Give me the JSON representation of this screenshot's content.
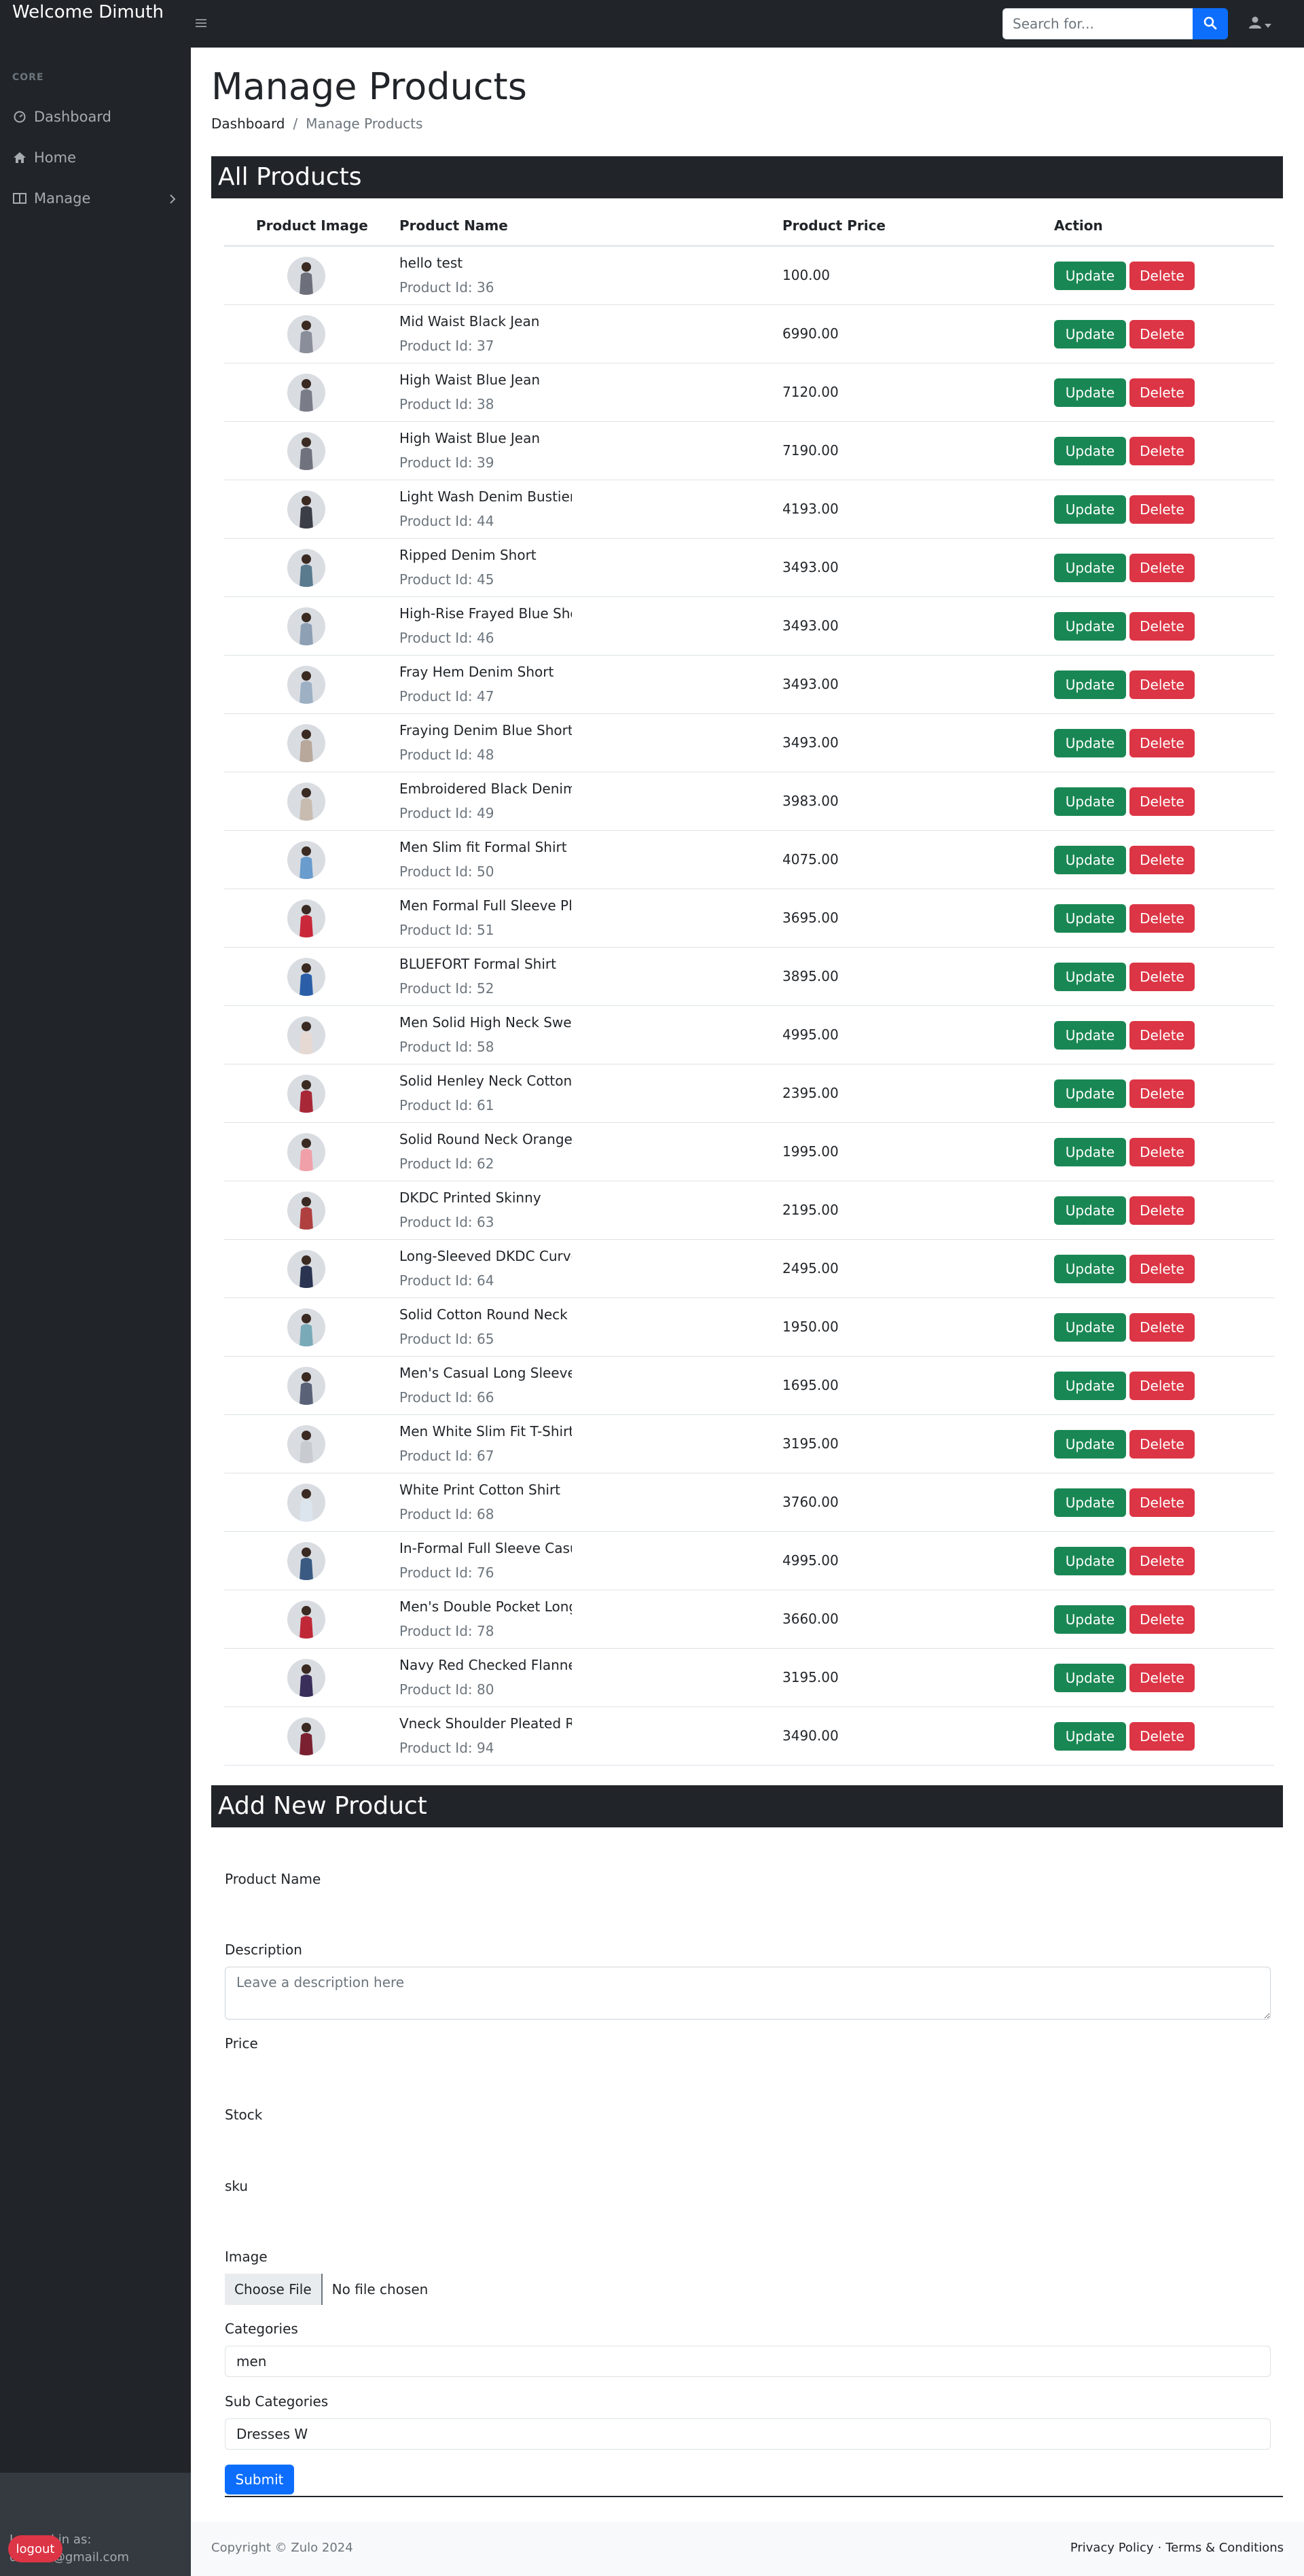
{
  "navbar": {
    "brand": "Welcome Dimuth",
    "search_placeholder": "Search for...",
    "toggle_icon": "menu-icon",
    "search_icon": "search-icon",
    "user_icon": "user-icon"
  },
  "sidebar": {
    "heading": "CORE",
    "items": [
      {
        "label": "Dashboard",
        "icon": "gauge-icon"
      },
      {
        "label": "Home",
        "icon": "home-icon"
      },
      {
        "label": "Manage",
        "icon": "columns-icon"
      }
    ],
    "logged_in_label": "Logged in as:",
    "logged_in_email": "dimuth@gmail.com",
    "logout_label": "logout"
  },
  "page": {
    "title": "Manage Products",
    "breadcrumb_home": "Dashboard",
    "breadcrumb_sep": "/",
    "breadcrumb_current": "Manage Products"
  },
  "products_section": {
    "title": "All Products",
    "headers": [
      "Product Image",
      "Product Name",
      "Product Price",
      "Action"
    ],
    "id_prefix": "Product Id: ",
    "update_label": "Update",
    "delete_label": "Delete",
    "rows": [
      {
        "name": "hello test",
        "id": "36",
        "price": "100.00",
        "color": "#6d6f7a"
      },
      {
        "name": "Mid Waist Black Jean",
        "id": "37",
        "price": "6990.00",
        "color": "#8a8d9a"
      },
      {
        "name": "High Waist Blue Jean",
        "id": "38",
        "price": "7120.00",
        "color": "#7a7d88"
      },
      {
        "name": "High Waist Blue Jean",
        "id": "39",
        "price": "7190.00",
        "color": "#70737e"
      },
      {
        "name": "Light Wash Denim Bustier",
        "id": "44",
        "price": "4193.00",
        "color": "#3b3e46"
      },
      {
        "name": "Ripped Denim Short",
        "id": "45",
        "price": "3493.00",
        "color": "#5a7a8e"
      },
      {
        "name": "High-Rise Frayed Blue Short",
        "id": "46",
        "price": "3493.00",
        "color": "#8ea0b4"
      },
      {
        "name": "Fray Hem Denim Short",
        "id": "47",
        "price": "3493.00",
        "color": "#9db0c4"
      },
      {
        "name": "Fraying Denim Blue Shorts",
        "id": "48",
        "price": "3493.00",
        "color": "#b8a89c"
      },
      {
        "name": "Embroidered Black Denim",
        "id": "49",
        "price": "3983.00",
        "color": "#c8bcb0"
      },
      {
        "name": "Men Slim fit Formal Shirt",
        "id": "50",
        "price": "4075.00",
        "color": "#6a9ccd"
      },
      {
        "name": " Men Formal Full Sleeve Plain",
        "id": "51",
        "price": "3695.00",
        "color": "#c8283a"
      },
      {
        "name": "BLUEFORT Formal Shirt",
        "id": "52",
        "price": "3895.00",
        "color": "#2a5fa8"
      },
      {
        "name": "Men Solid High Neck Sweater",
        "id": "58",
        "price": "4995.00",
        "color": "#e6d8d2"
      },
      {
        "name": "Solid Henley Neck Cotton",
        "id": "61",
        "price": "2395.00",
        "color": "#a82838"
      },
      {
        "name": "Solid Round Neck Orange",
        "id": "62",
        "price": "1995.00",
        "color": "#f0a0a8"
      },
      {
        "name": "DKDC Printed Skinny",
        "id": "63",
        "price": "2195.00",
        "color": "#b04040"
      },
      {
        "name": "Long-Sleeved DKDC Curved",
        "id": "64",
        "price": "2495.00",
        "color": "#2a3450"
      },
      {
        "name": "Solid Cotton Round Neck",
        "id": "65",
        "price": "1950.00",
        "color": "#7aaab8"
      },
      {
        "name": "Men's Casual Long Sleeve",
        "id": "66",
        "price": "1695.00",
        "color": "#5a6278"
      },
      {
        "name": "Men White Slim Fit T-Shirt",
        "id": "67",
        "price": "3195.00",
        "color": "#c8ccd0"
      },
      {
        "name": "White Print Cotton Shirt",
        "id": "68",
        "price": "3760.00",
        "color": "#dce4ee"
      },
      {
        "name": "In-Formal Full Sleeve Casual",
        "id": "76",
        "price": "4995.00",
        "color": "#3a5a82"
      },
      {
        "name": "Men's Double Pocket Long",
        "id": "78",
        "price": "3660.00",
        "color": "#c02838"
      },
      {
        "name": "Navy Red Checked Flannel",
        "id": "80",
        "price": "3195.00",
        "color": "#3a2e5a"
      },
      {
        "name": "Vneck Shoulder Pleated Rib",
        "id": "94",
        "price": "3490.00",
        "color": "#7a2030"
      }
    ]
  },
  "add_section": {
    "title": "Add New Product",
    "product_name_label": "Product Name",
    "product_name_value": "",
    "description_label": "Description",
    "description_placeholder": "Leave a description here",
    "price_label": "Price",
    "price_value": "",
    "stock_label": "Stock",
    "stock_value": "",
    "sku_label": "sku",
    "sku_value": "",
    "image_label": "Image",
    "file_button": "Choose File",
    "file_status": "No file chosen",
    "categories_label": "Categories",
    "categories_value": "men",
    "subcategories_label": "Sub Categories",
    "subcategories_value": "Dresses W",
    "submit_label": "Submit"
  },
  "footer": {
    "copyright": "Copyright © Zulo 2024",
    "privacy": "Privacy Policy",
    "separator": "·",
    "terms": "Terms & Conditions"
  }
}
